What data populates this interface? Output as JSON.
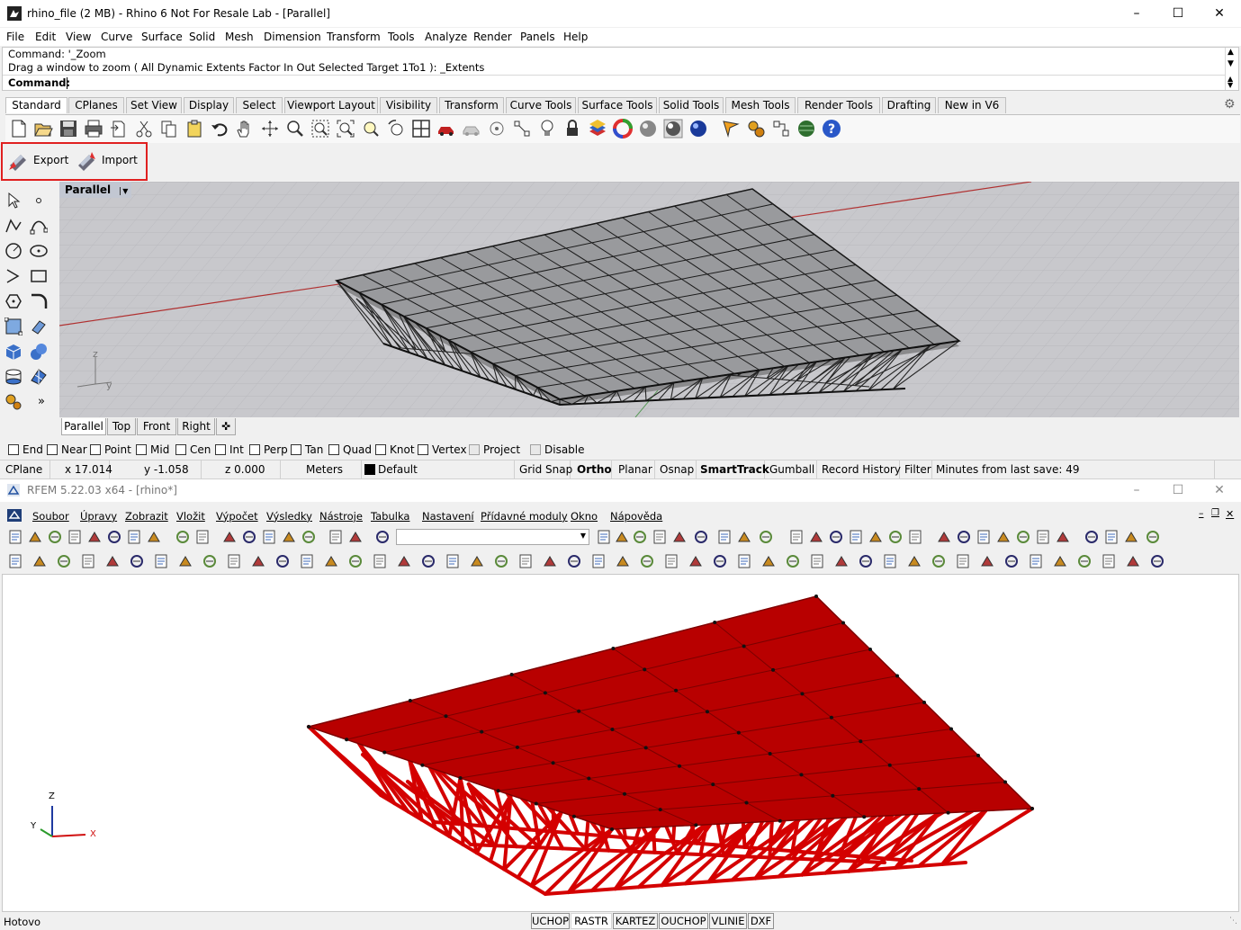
{
  "rhino": {
    "title": "rhino_file (2 MB) - Rhino 6 Not For Resale Lab - [Parallel]",
    "menu": [
      "File",
      "Edit",
      "View",
      "Curve",
      "Surface",
      "Solid",
      "Mesh",
      "Dimension",
      "Transform",
      "Tools",
      "Analyze",
      "Render",
      "Panels",
      "Help"
    ],
    "command_history": [
      "Command: '_Zoom",
      "Drag a window to zoom ( All  Dynamic  Extents  Factor  In  Out  Selected  Target  1To1 ): _Extents"
    ],
    "command_prompt": "Command:",
    "toolbar_tabs": [
      "Standard",
      "CPlanes",
      "Set View",
      "Display",
      "Select",
      "Viewport Layout",
      "Visibility",
      "Transform",
      "Curve Tools",
      "Surface Tools",
      "Solid Tools",
      "Mesh Tools",
      "Render Tools",
      "Drafting",
      "New in V6"
    ],
    "export_label": "Export",
    "import_label": "Import",
    "viewport_name": "Parallel",
    "viewport_tabs": [
      "Parallel",
      "Top",
      "Front",
      "Right"
    ],
    "axis_labels": {
      "z": "z",
      "y": "y"
    },
    "osnaps": [
      {
        "label": "End",
        "checked": false
      },
      {
        "label": "Near",
        "checked": false
      },
      {
        "label": "Point",
        "checked": false
      },
      {
        "label": "Mid",
        "checked": false
      },
      {
        "label": "Cen",
        "checked": false
      },
      {
        "label": "Int",
        "checked": false
      },
      {
        "label": "Perp",
        "checked": false
      },
      {
        "label": "Tan",
        "checked": false
      },
      {
        "label": "Quad",
        "checked": false
      },
      {
        "label": "Knot",
        "checked": false
      },
      {
        "label": "Vertex",
        "checked": false
      },
      {
        "label": "Project",
        "checked": false
      },
      {
        "label": "Disable",
        "checked": false
      }
    ],
    "status": {
      "cplane": "CPlane",
      "x": "x 17.014",
      "y": "y -1.058",
      "z": "z 0.000",
      "units": "Meters",
      "layer": "Default",
      "grid_snap": "Grid Snap",
      "ortho": "Ortho",
      "planar": "Planar",
      "osnap": "Osnap",
      "smarttrack": "SmartTrack",
      "gumball": "Gumball",
      "record_history": "Record History",
      "filter": "Filter",
      "save_info": "Minutes from last save: 49"
    }
  },
  "rfem": {
    "title": "RFEM 5.22.03 x64 - [rhino*]",
    "menu": [
      "Soubor",
      "Úpravy",
      "Zobrazit",
      "Vložit",
      "Výpočet",
      "Výsledky",
      "Nástroje",
      "Tabulka",
      "Nastavení",
      "Přídavné moduly",
      "Okno",
      "Nápověda"
    ],
    "axis_labels": {
      "z": "Z",
      "y": "Y",
      "x": "X"
    },
    "status_left": "Hotovo",
    "status_buttons": [
      "UCHOP",
      "RASTR",
      "KARTEZ",
      "OUCHOP",
      "VLINIE",
      "DXF"
    ],
    "colors": {
      "model": "#b80000",
      "model_line": "#d40000",
      "node": "#1a1a1a"
    }
  }
}
